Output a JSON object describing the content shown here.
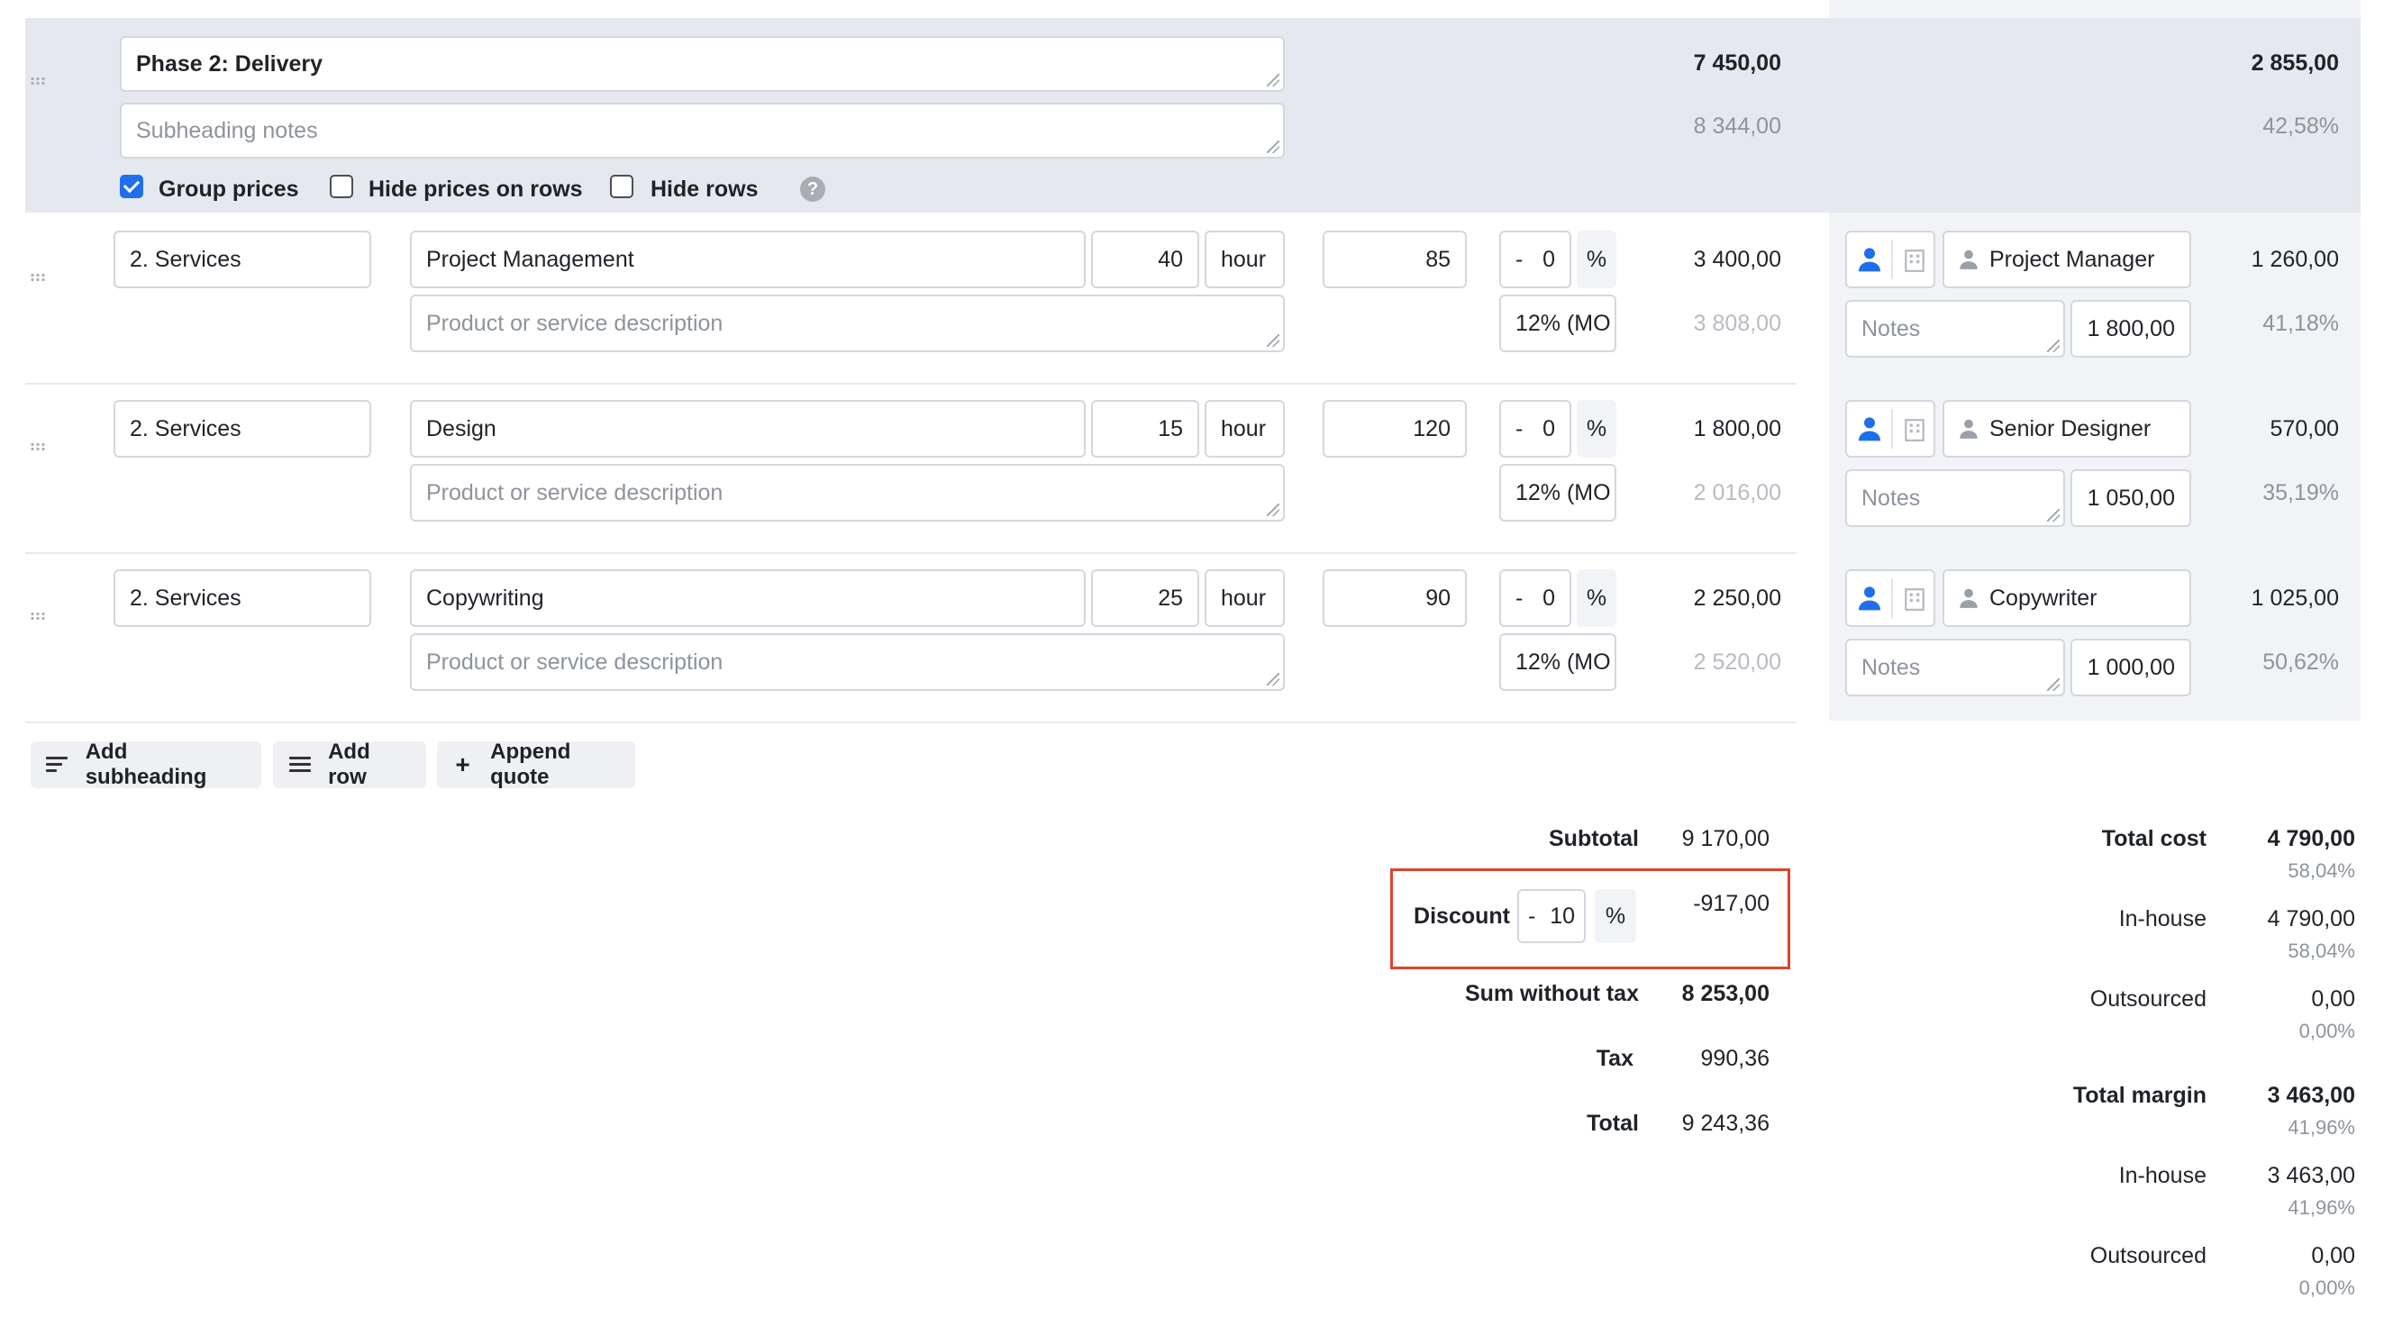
{
  "phase": {
    "title": "Phase 2: Delivery",
    "notes_placeholder": "Subheading notes",
    "total": "7 450,00",
    "total_with_tax": "8 344,00",
    "margin": "2 855,00",
    "margin_pct": "42,58%",
    "options": [
      {
        "label": "Group prices",
        "checked": true
      },
      {
        "label": "Hide prices on rows",
        "checked": false
      },
      {
        "label": "Hide rows",
        "checked": false
      }
    ],
    "help_glyph": "?"
  },
  "rows": [
    {
      "category": "2. Services",
      "name": "Project Management",
      "description_placeholder": "Product or service description",
      "quantity": "40",
      "unit": "hour",
      "price": "85",
      "discount_sign": "-",
      "discount": "0",
      "discount_unit": "%",
      "tax": "12% (MO",
      "total": "3 400,00",
      "total_with_tax": "3 808,00",
      "resource": "Project Manager",
      "notes_placeholder": "Notes",
      "cost": "1 800,00",
      "margin": "1 260,00",
      "margin_pct": "41,18%"
    },
    {
      "category": "2. Services",
      "name": "Design",
      "description_placeholder": "Product or service description",
      "quantity": "15",
      "unit": "hour",
      "price": "120",
      "discount_sign": "-",
      "discount": "0",
      "discount_unit": "%",
      "tax": "12% (MO",
      "total": "1 800,00",
      "total_with_tax": "2 016,00",
      "resource": "Senior Designer",
      "notes_placeholder": "Notes",
      "cost": "1 050,00",
      "margin": "570,00",
      "margin_pct": "35,19%"
    },
    {
      "category": "2. Services",
      "name": "Copywriting",
      "description_placeholder": "Product or service description",
      "quantity": "25",
      "unit": "hour",
      "price": "90",
      "discount_sign": "-",
      "discount": "0",
      "discount_unit": "%",
      "tax": "12% (MO",
      "total": "2 250,00",
      "total_with_tax": "2 520,00",
      "resource": "Copywriter",
      "notes_placeholder": "Notes",
      "cost": "1 000,00",
      "margin": "1 025,00",
      "margin_pct": "50,62%"
    }
  ],
  "actions": {
    "add_subheading": "Add subheading",
    "add_row": "Add row",
    "append_quote": "Append quote",
    "plus_glyph": "+"
  },
  "summary": {
    "subtotal_label": "Subtotal",
    "subtotal": "9 170,00",
    "discount_label": "Discount",
    "discount_sign": "-",
    "discount_value": "10",
    "discount_unit": "%",
    "discount_amount": "-917,00",
    "sum_without_tax_label": "Sum without tax",
    "sum_without_tax": "8 253,00",
    "tax_label": "Tax",
    "tax": "990,36",
    "total_label": "Total",
    "total": "9 243,36"
  },
  "costs": {
    "total_cost_label": "Total cost",
    "total_cost": "4 790,00",
    "total_cost_pct": "58,04%",
    "inhouse_label": "In-house",
    "inhouse_cost": "4 790,00",
    "inhouse_cost_pct": "58,04%",
    "outsourced_label": "Outsourced",
    "outsourced_cost": "0,00",
    "outsourced_cost_pct": "0,00%",
    "total_margin_label": "Total margin",
    "total_margin": "3 463,00",
    "total_margin_pct": "41,96%",
    "inhouse_margin_label": "In-house",
    "inhouse_margin": "3 463,00",
    "inhouse_margin_pct": "41,96%",
    "outsourced_margin_label": "Outsourced",
    "outsourced_margin": "0,00",
    "outsourced_margin_pct": "0,00%"
  },
  "colors": {
    "accent": "#1f6feb",
    "highlight": "#e0432b",
    "band": "#e5e8ef",
    "side_panel": "#f1f3f7"
  }
}
